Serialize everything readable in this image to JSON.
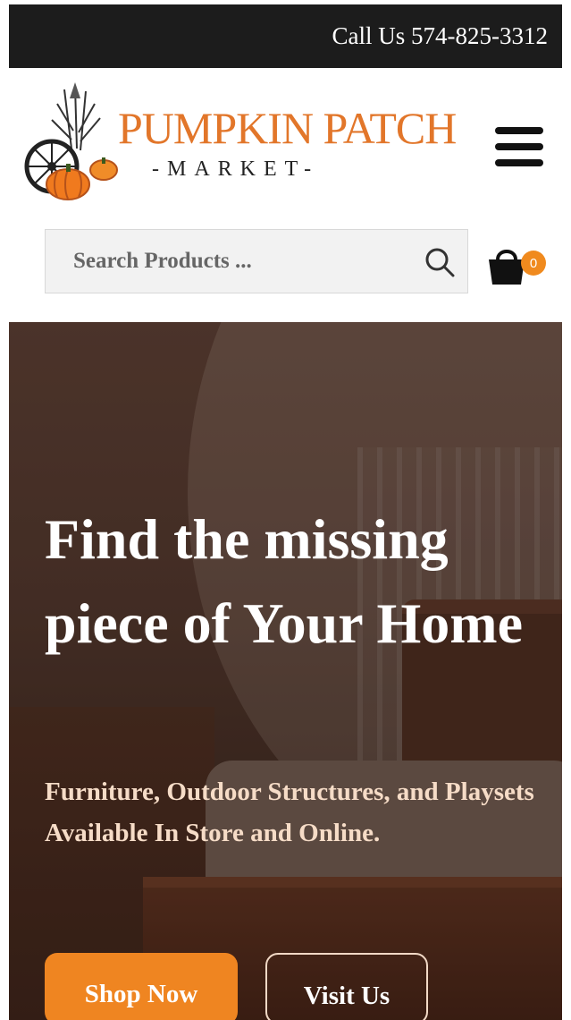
{
  "topbar": {
    "call_text": "Call Us 574-825-3312"
  },
  "logo": {
    "name_main": "PUMPKIN PATCH",
    "name_sub": "-MARKET-"
  },
  "search": {
    "placeholder": "Search Products ..."
  },
  "cart": {
    "count": "0"
  },
  "hero": {
    "headline": "Find the missing piece of Your Home",
    "subtext": "Furniture, Outdoor Structures, and Playsets Available In Store and Online.",
    "shop_label": "Shop Now",
    "visit_label": "Visit Us"
  },
  "colors": {
    "accent": "#ef8521",
    "topbar": "#1c1c1c",
    "logo_orange": "#e2762a"
  },
  "icons": [
    "hamburger-menu-icon",
    "search-icon",
    "shopping-bag-icon"
  ]
}
